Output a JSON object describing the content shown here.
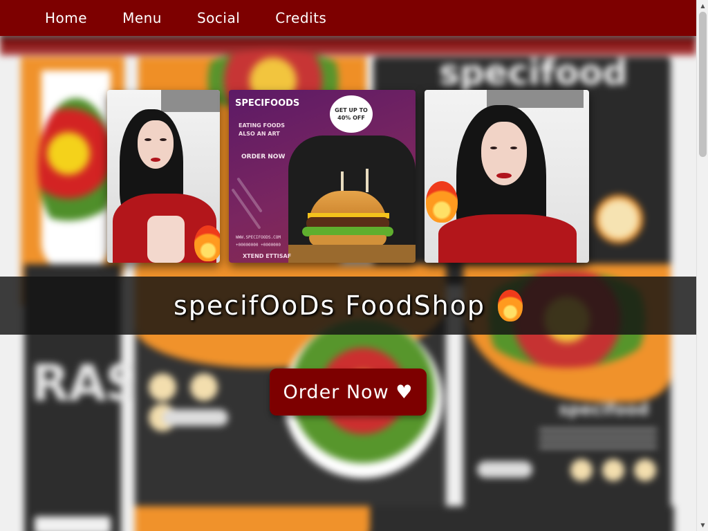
{
  "nav": {
    "items": [
      {
        "label": "Home"
      },
      {
        "label": "Menu"
      },
      {
        "label": "Social"
      },
      {
        "label": "Credits"
      }
    ]
  },
  "background": {
    "brand_word": "specifood",
    "brand_word_small": "specifood",
    "side_word": "RAS"
  },
  "gallery": {
    "poster": {
      "title": "SPECIFOODS",
      "badge": "GET UP TO 40% OFF",
      "tagline": "EATING FOODS ALSO AN ART",
      "order": "ORDER NOW",
      "lines": [
        "WWW.SPECIFOODS.COM",
        "+00000000 +0000000"
      ],
      "brand": "XTEND ETTISAF"
    }
  },
  "hero": {
    "title": "specifOoDs FoodShop",
    "title_icon": "fire-icon"
  },
  "cta": {
    "label": "Order Now ♥"
  },
  "colors": {
    "nav_bg": "#7d0000",
    "cta_bg": "#7d0000",
    "band_bg": "#141414",
    "accent_orange": "#f0922b"
  }
}
